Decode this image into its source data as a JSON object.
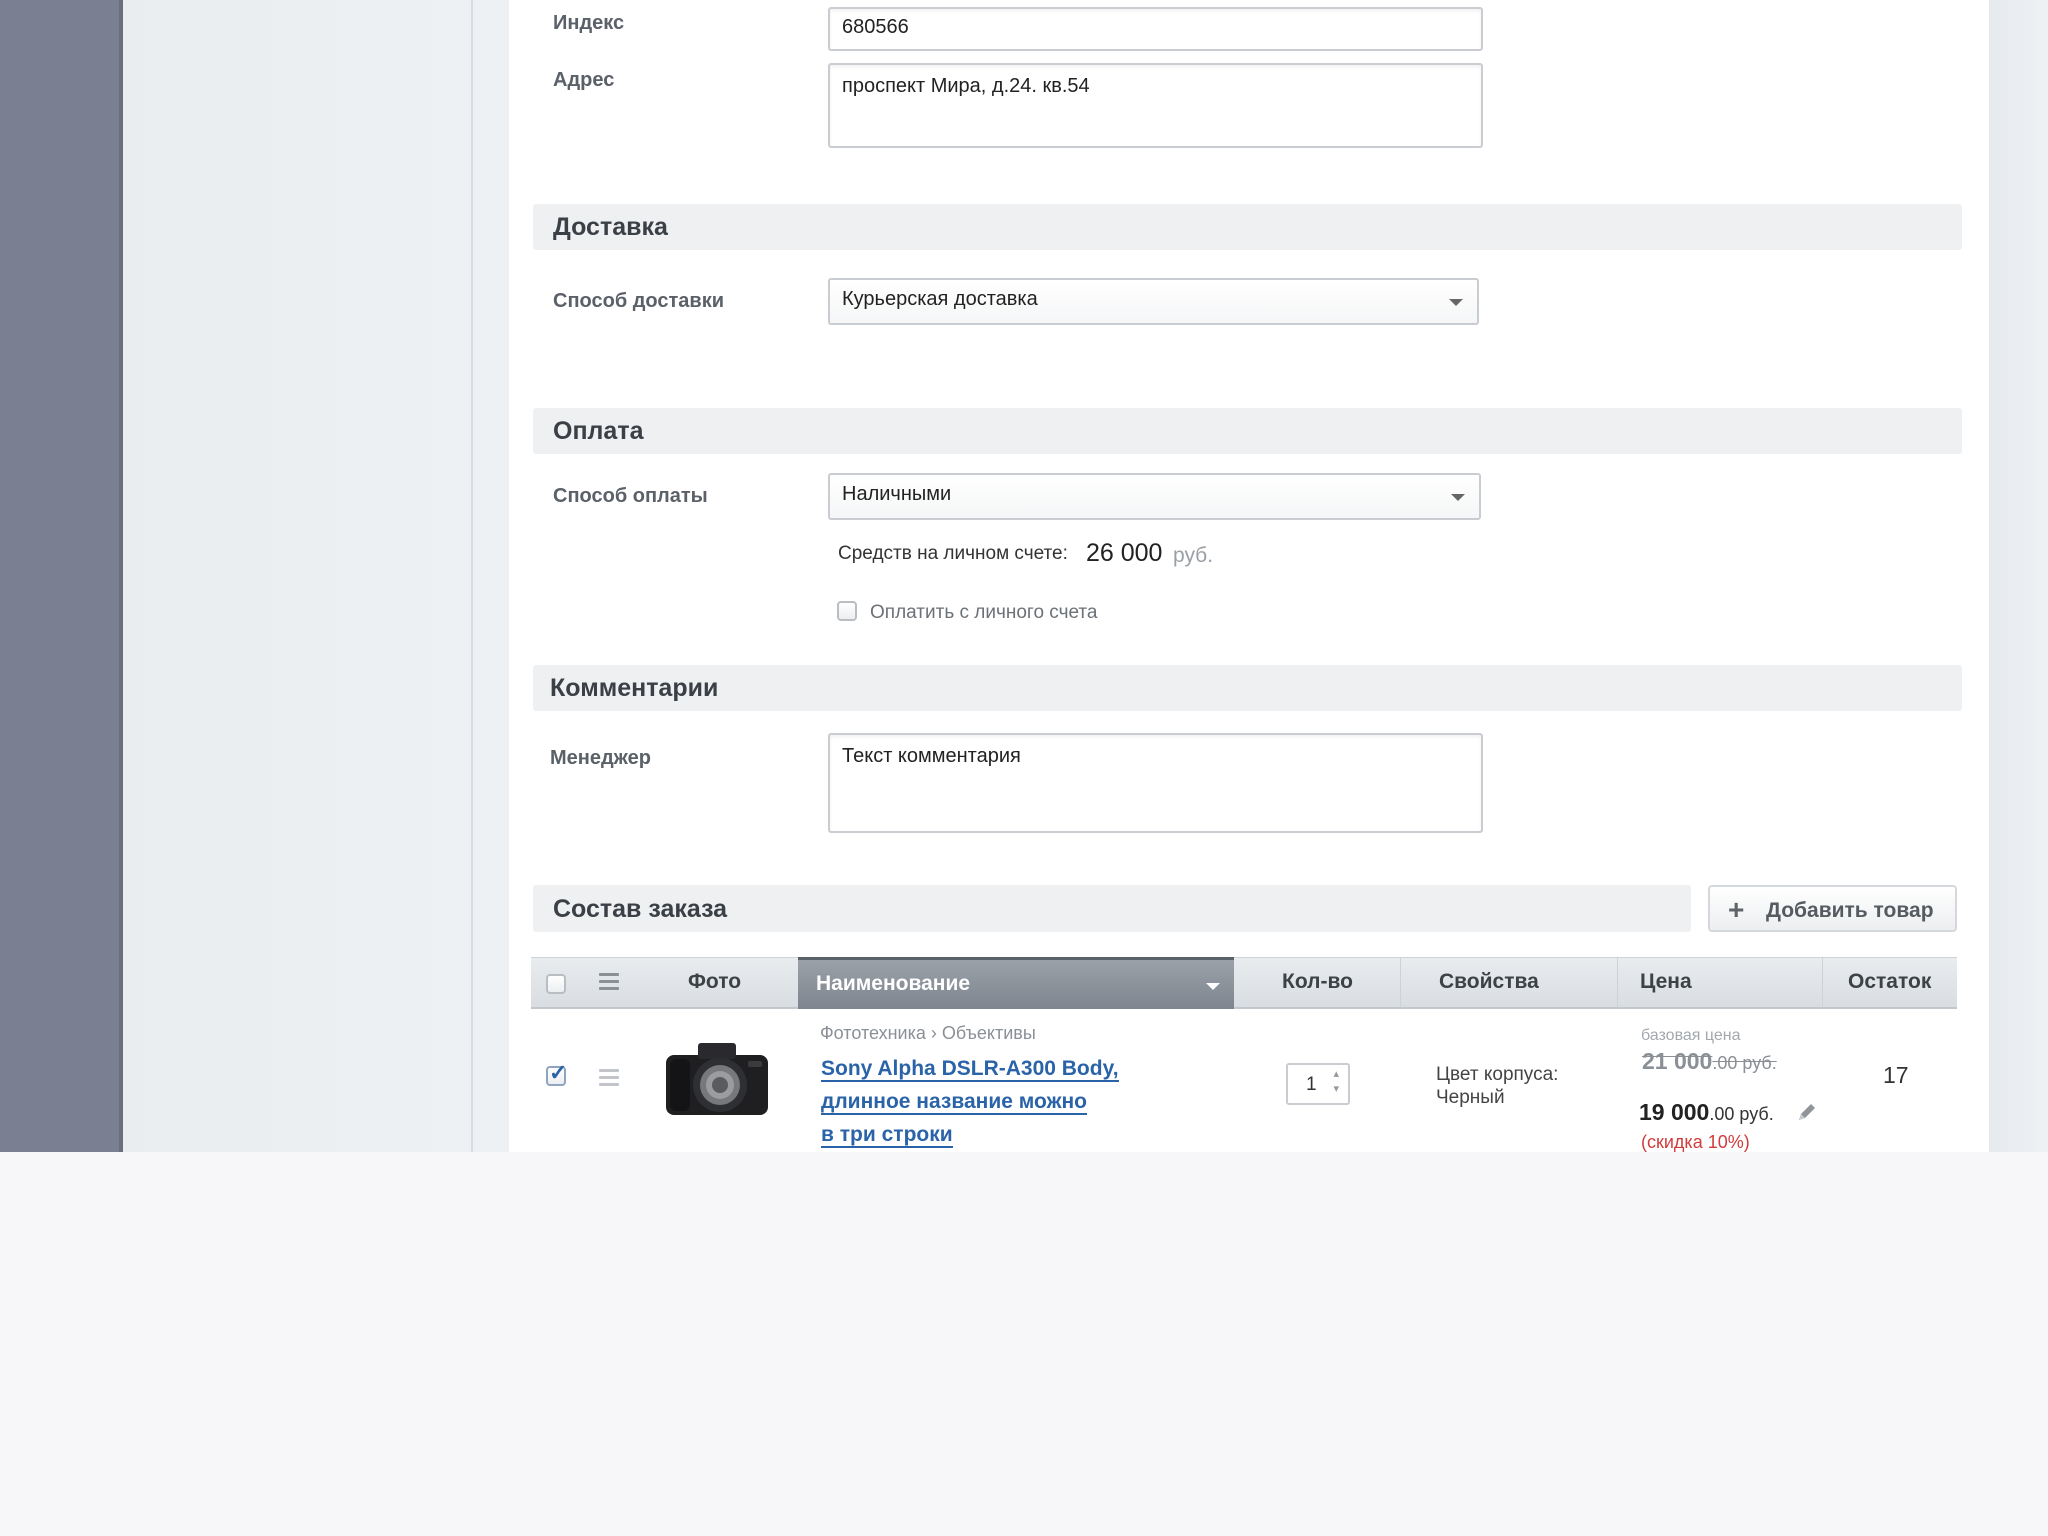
{
  "address": {
    "index_label": "Индекс",
    "index_value": "680566",
    "address_label": "Адрес",
    "address_value": "проспект Мира, д.24. кв.54"
  },
  "delivery": {
    "section_title": "Доставка",
    "method_label": "Способ доставки",
    "method_value": "Курьерская доставка"
  },
  "payment": {
    "section_title": "Оплата",
    "method_label": "Способ оплаты",
    "method_value": "Наличными",
    "balance_label": "Средств на личном счете:",
    "balance_amount": "26 000",
    "balance_currency": "руб.",
    "pay_from_account_label": "Оплатить с личного счета",
    "pay_from_account_checked": false
  },
  "comments": {
    "section_title": "Комментарии",
    "manager_label": "Менеджер",
    "manager_value": "Текст комментария"
  },
  "order": {
    "section_title": "Состав заказа",
    "add_button_label": "Добавить товар",
    "columns": {
      "photo": "Фото",
      "name": "Наименование",
      "qty": "Кол-во",
      "props": "Свойства",
      "price": "Цена",
      "stock": "Остаток"
    },
    "items": [
      {
        "checked": true,
        "breadcrumb_cat": "Фототехника",
        "breadcrumb_sep": "›",
        "breadcrumb_sub": "Объективы",
        "name_line1": "Sony Alpha DSLR-A300 Body,",
        "name_line2": "длинное название можно",
        "name_line3": "в три строки",
        "qty": "1",
        "prop_line1": "Цвет корпуса:",
        "prop_line2": "Черный",
        "base_price_label": "базовая цена",
        "old_price_int": "21 000",
        "old_price_dec": ".00 руб.",
        "price_int": "19 000",
        "price_dec": ".00 руб.",
        "discount": "(скидка 10%)",
        "stock": "17"
      }
    ]
  },
  "colors": {
    "link": "#2a63a8",
    "discount": "#d23b3b",
    "sidebar": "#7a7f91"
  }
}
